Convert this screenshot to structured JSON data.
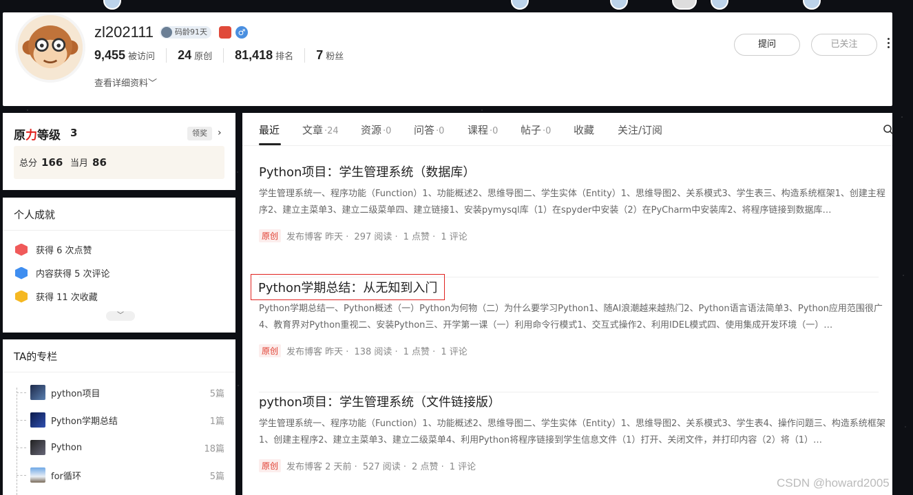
{
  "profile": {
    "username": "zl202111",
    "code_age_badge": "码龄91天",
    "stats": [
      {
        "num": "9,455",
        "label": "被访问"
      },
      {
        "num": "24",
        "label": "原创"
      },
      {
        "num": "81,418",
        "label": "排名"
      },
      {
        "num": "7",
        "label": "粉丝"
      }
    ],
    "details_link": "查看详细资料",
    "ask_button": "提问",
    "followed_button": "已关注"
  },
  "level": {
    "title_part1": "原",
    "title_part2": "力",
    "title_part3": "等级",
    "level_value": "3",
    "claim_button": "领奖",
    "total_label": "总分",
    "total_value": "166",
    "month_label": "当月",
    "month_value": "86"
  },
  "achievements": {
    "title": "个人成就",
    "items": [
      {
        "text": "获得 6 次点赞",
        "icon": "like-hex-icon",
        "color": "#f05a5a"
      },
      {
        "text": "内容获得 5 次评论",
        "icon": "comment-hex-icon",
        "color": "#3f8ef0"
      },
      {
        "text": "获得 11 次收藏",
        "icon": "star-hex-icon",
        "color": "#f5b822"
      }
    ]
  },
  "columns": {
    "title": "TA的专栏",
    "items": [
      {
        "name": "python项目",
        "count": "5篇"
      },
      {
        "name": "Python学期总结",
        "count": "1篇"
      },
      {
        "name": "Python",
        "count": "18篇"
      },
      {
        "name": "for循环",
        "count": "5篇"
      }
    ]
  },
  "tabs": [
    {
      "label": "最近",
      "count": ""
    },
    {
      "label": "文章",
      "count": "·24"
    },
    {
      "label": "资源",
      "count": "·0"
    },
    {
      "label": "问答",
      "count": "·0"
    },
    {
      "label": "课程",
      "count": "·0"
    },
    {
      "label": "帖子",
      "count": "·0"
    },
    {
      "label": "收藏",
      "count": ""
    },
    {
      "label": "关注/订阅",
      "count": ""
    }
  ],
  "articles": [
    {
      "title": "Python项目：学生管理系统（数据库）",
      "desc": "学生管理系统一、程序功能（Function）1、功能概述2、思维导图二、学生实体（Entity）1、思维导图2、关系模式3、学生表三、构造系统框架1、创建主程序2、建立主菜单3、建立二级菜单四、建立链接1、安装pymysql库（1）在spyder中安装（2）在PyCharm中安装库2、将程序链接到数据库…",
      "tag": "原创",
      "publish": "发布博客 昨天 ·",
      "reads": "297 阅读 ·",
      "likes": "1 点赞 ·",
      "comments": "1 评论"
    },
    {
      "title": "Python学期总结：从无知到入门",
      "desc": "Python学期总结一、Python概述（一）Python为何物（二）为什么要学习Python1、随AI浪潮越来越热门2、Python语言语法简单3、Python应用范围很广4、教育界对Python重视二、安装Python三、开学第一课（一）利用命令行模式1、交互式操作2、利用IDEL模式四、使用集成开发环境（一）…",
      "tag": "原创",
      "publish": "发布博客 昨天 ·",
      "reads": "138 阅读 ·",
      "likes": "1 点赞 ·",
      "comments": "1 评论"
    },
    {
      "title": "python项目：学生管理系统（文件链接版）",
      "desc": "学生管理系统一、程序功能（Function）1、功能概述2、思维导图二、学生实体（Entity）1、思维导图2、关系模式3、学生表4、操作问题三、构造系统框架1、创建主程序2、建立主菜单3、建立二级菜单4、利用Python将程序链接到学生信息文件（1）打开、关闭文件，并打印内容（2）将（1）…",
      "tag": "原创",
      "publish": "发布博客 2 天前 ·",
      "reads": "527 阅读 ·",
      "likes": "2 点赞 ·",
      "comments": "1 评论"
    }
  ],
  "watermark": "CSDN @howard2005"
}
